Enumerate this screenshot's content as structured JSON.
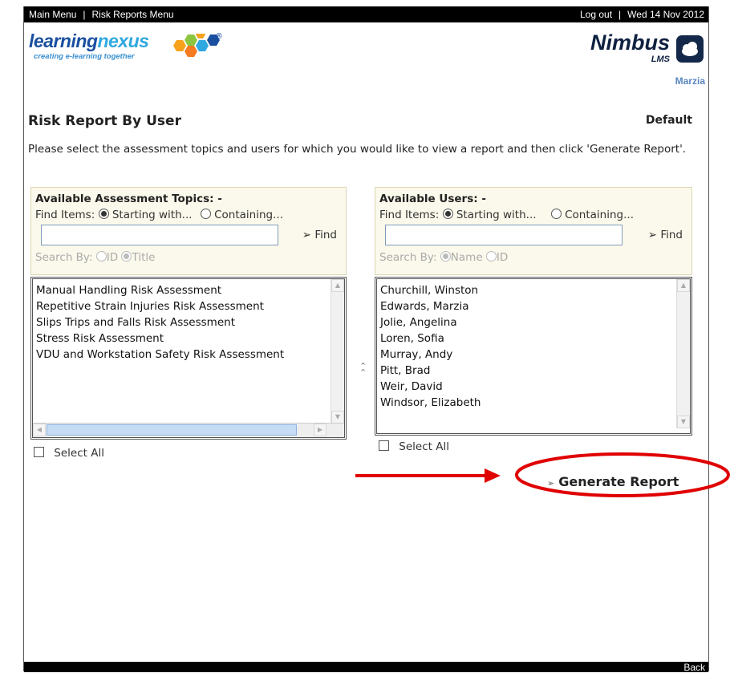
{
  "topbar": {
    "main_menu": "Main Menu",
    "risk_reports_menu": "Risk Reports Menu",
    "logout": "Log out",
    "date": "Wed 14 Nov 2012"
  },
  "branding": {
    "logo_part1": "learning",
    "logo_part2": "nexus",
    "logo_mark": "®",
    "tagline": "creating e-learning together",
    "product": "Nimbus",
    "product_sub": "LMS",
    "user": "Marzia"
  },
  "page": {
    "title": "Risk Report By User",
    "profile": "Default",
    "instructions": "Please select the assessment topics and users for which you would like to view a report and then click 'Generate Report'."
  },
  "topics": {
    "header": "Available Assessment Topics: -",
    "find_items_label": "Find Items:",
    "starting_with": "Starting with...",
    "containing": "Containing...",
    "find_button": "Find",
    "search_input": "",
    "search_by_label": "Search By:",
    "search_by_option1": "ID",
    "search_by_option2": "Title",
    "items": [
      "Manual Handling Risk Assessment",
      "Repetitive Strain Injuries Risk Assessment",
      "Slips Trips and Falls Risk Assessment",
      "Stress Risk Assessment",
      "VDU and Workstation Safety Risk Assessment"
    ],
    "select_all": "Select All"
  },
  "users": {
    "header": "Available Users: -",
    "find_items_label": "Find Items:",
    "starting_with": "Starting with...",
    "containing": "Containing...",
    "find_button": "Find",
    "search_input": "",
    "search_by_label": "Search By:",
    "search_by_option1": "Name",
    "search_by_option2": "ID",
    "items": [
      "Churchill, Winston",
      "Edwards, Marzia",
      "Jolie, Angelina",
      "Loren, Sofia",
      "Murray, Andy",
      "Pitt, Brad",
      "Weir, David",
      "Windsor, Elizabeth"
    ],
    "select_all": "Select All"
  },
  "actions": {
    "generate": "Generate Report",
    "back": "Back"
  },
  "colors": {
    "annotation_red": "#e00000",
    "panel_bg": "#fbf9eb",
    "brand_blue": "#1a4fa0"
  }
}
